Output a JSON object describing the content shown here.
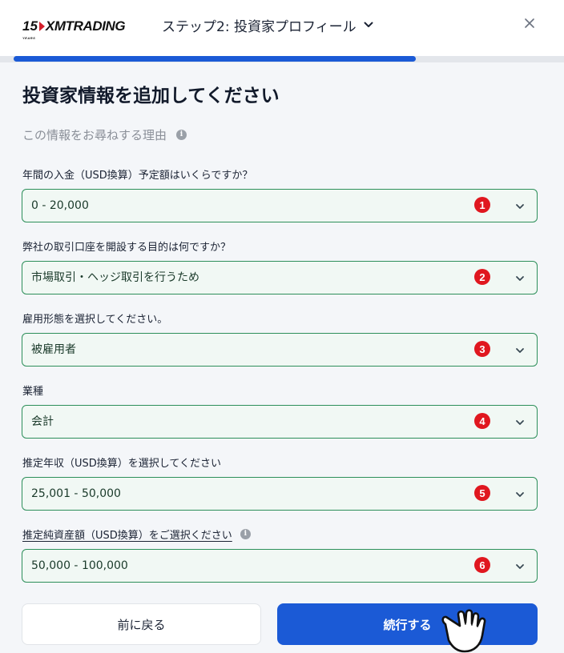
{
  "header": {
    "logo_number": "15",
    "logo_years": "YEARS",
    "logo_text": "XMTRADING",
    "step_title": "ステップ2: 投資家プロフィール",
    "progress": 0.73
  },
  "main": {
    "title": "投資家情報を追加してください",
    "reason_link": "この情報をお尋ねする理由"
  },
  "fields": [
    {
      "label": "年間の入金（USD換算）予定額はいくらですか？",
      "value": "0 - 20,000",
      "badge": "1"
    },
    {
      "label": "弊社の取引口座を開設する目的は何ですか？",
      "value": "市場取引・ヘッジ取引を行うため",
      "badge": "2"
    },
    {
      "label": "雇用形態を選択してください。",
      "value": "被雇用者",
      "badge": "3"
    },
    {
      "label": "業種",
      "value": "会計",
      "badge": "4"
    },
    {
      "label": "推定年収（USD換算）を選択してください",
      "value": "25,001 - 50,000",
      "badge": "5"
    },
    {
      "label": "推定純資産額（USD換算）をご選択ください",
      "value": "50,000 - 100,000",
      "badge": "6"
    }
  ],
  "buttons": {
    "back": "前に戻る",
    "continue": "続行する"
  },
  "colors": {
    "primary": "#1b5ad6",
    "field_border": "#2d8f5a",
    "field_bg": "#f1f8f4",
    "badge": "#e0171f"
  }
}
